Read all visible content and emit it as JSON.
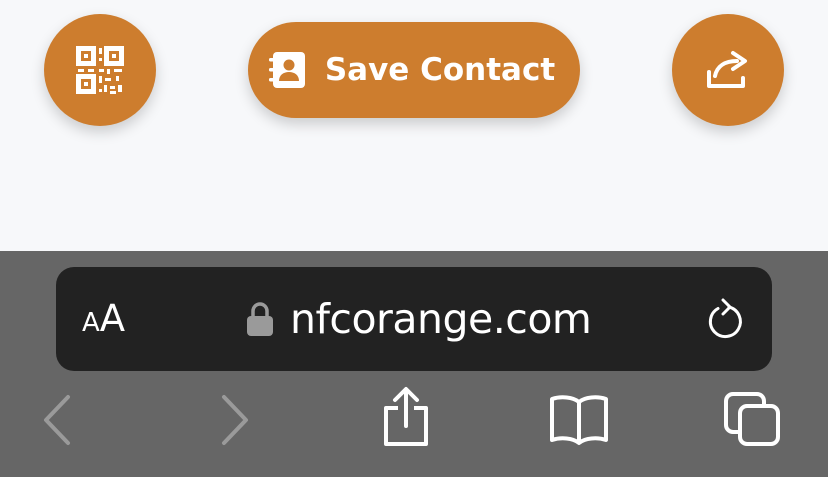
{
  "colors": {
    "accent": "#cd7d2e",
    "page_background": "#f7f8fa",
    "toolbar_background": "#666666",
    "address_bar_background": "#222222",
    "icon_white": "#ffffff",
    "icon_disabled": "#9a9a9a"
  },
  "page": {
    "qr_button": {
      "icon": "qr-code-icon"
    },
    "save_contact_button": {
      "label": "Save Contact",
      "icon": "address-book-icon"
    },
    "share_button": {
      "icon": "share-arrow-icon"
    }
  },
  "browser": {
    "address_bar": {
      "text_size_small": "A",
      "text_size_large": "A",
      "lock_icon": "lock-icon",
      "url": "nfcorange.com",
      "reload_icon": "reload-icon"
    },
    "toolbar": {
      "back_icon": "chevron-left-icon",
      "forward_icon": "chevron-right-icon",
      "share_icon": "share-icon",
      "bookmarks_icon": "book-icon",
      "tabs_icon": "tabs-icon"
    }
  }
}
